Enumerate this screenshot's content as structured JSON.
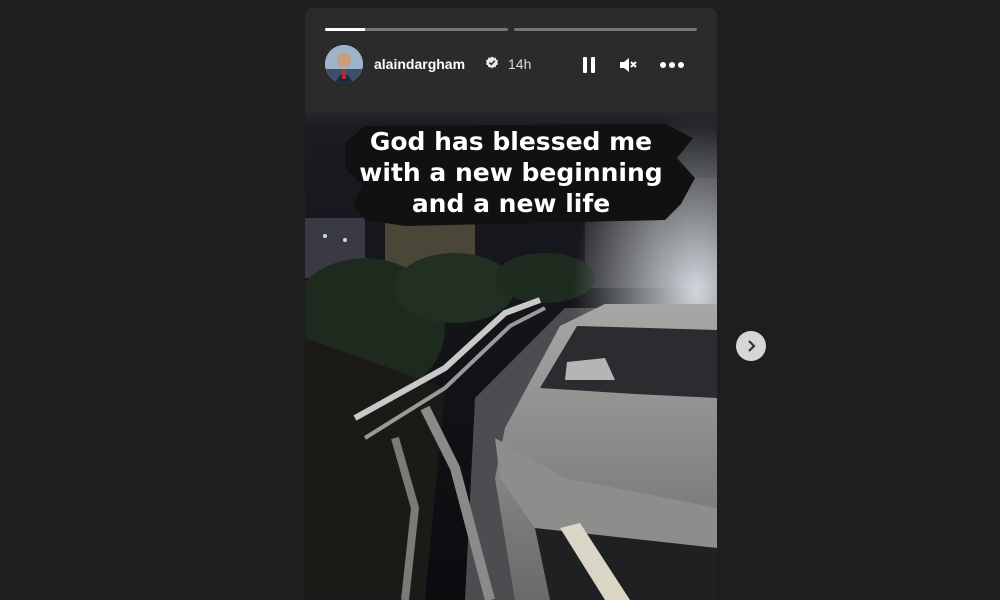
{
  "story": {
    "user": {
      "username": "alaindargham",
      "verified": true,
      "timestamp": "14h"
    },
    "progress": [
      {
        "segment": 1,
        "filled_fraction": 0.22
      },
      {
        "segment": 2,
        "filled_fraction": 0
      }
    ],
    "controls": {
      "pause_icon": "pause-icon",
      "mute_icon": "muted-speaker-icon",
      "more_icon": "more-options-icon"
    },
    "caption": {
      "line1": "God has blessed me",
      "line2": "with a new beginning",
      "line3": "and a new life"
    },
    "next_icon": "chevron-right-icon"
  },
  "colors": {
    "page_background": "#1e1e1e",
    "story_header_background": "#2b2b2b",
    "caption_highlight": "#111111",
    "next_button": "#d6d6d6"
  }
}
